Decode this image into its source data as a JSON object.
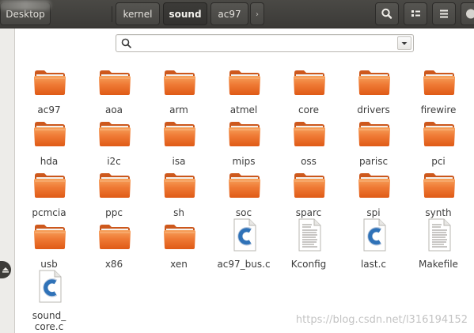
{
  "header": {
    "breadcrumbs": [
      {
        "label": "Desktop"
      },
      {
        "label": "kernel"
      },
      {
        "label": "sound",
        "active": true
      },
      {
        "label": "ac97"
      }
    ],
    "next_arrow": "›",
    "buttons": {
      "search": "search-icon",
      "view": "view-options-icon",
      "menu": "menu-icon"
    }
  },
  "search": {
    "placeholder": "",
    "value": ""
  },
  "items": [
    {
      "label": "ac97",
      "type": "folder"
    },
    {
      "label": "aoa",
      "type": "folder"
    },
    {
      "label": "arm",
      "type": "folder"
    },
    {
      "label": "atmel",
      "type": "folder"
    },
    {
      "label": "core",
      "type": "folder"
    },
    {
      "label": "drivers",
      "type": "folder"
    },
    {
      "label": "firewire",
      "type": "folder"
    },
    {
      "label": "hda",
      "type": "folder"
    },
    {
      "label": "i2c",
      "type": "folder"
    },
    {
      "label": "isa",
      "type": "folder"
    },
    {
      "label": "mips",
      "type": "folder"
    },
    {
      "label": "oss",
      "type": "folder"
    },
    {
      "label": "parisc",
      "type": "folder"
    },
    {
      "label": "pci",
      "type": "folder"
    },
    {
      "label": "pcmcia",
      "type": "folder"
    },
    {
      "label": "ppc",
      "type": "folder"
    },
    {
      "label": "sh",
      "type": "folder"
    },
    {
      "label": "soc",
      "type": "folder"
    },
    {
      "label": "sparc",
      "type": "folder"
    },
    {
      "label": "spi",
      "type": "folder"
    },
    {
      "label": "synth",
      "type": "folder"
    },
    {
      "label": "usb",
      "type": "folder"
    },
    {
      "label": "x86",
      "type": "folder"
    },
    {
      "label": "xen",
      "type": "folder"
    },
    {
      "label": "ac97_bus.c",
      "type": "c-source"
    },
    {
      "label": "Kconfig",
      "type": "text"
    },
    {
      "label": "last.c",
      "type": "c-source"
    },
    {
      "label": "Makefile",
      "type": "text"
    },
    {
      "label": "sound_\ncore.c",
      "type": "c-source"
    }
  ],
  "watermark": "https://blog.csdn.net/l316194152",
  "colors": {
    "header_bg": "#3c3b37",
    "folder_front": "#e95420",
    "folder_back": "#c6470f",
    "c_file_blue": "#2f72b8",
    "sidebar_bg": "#edece9"
  }
}
